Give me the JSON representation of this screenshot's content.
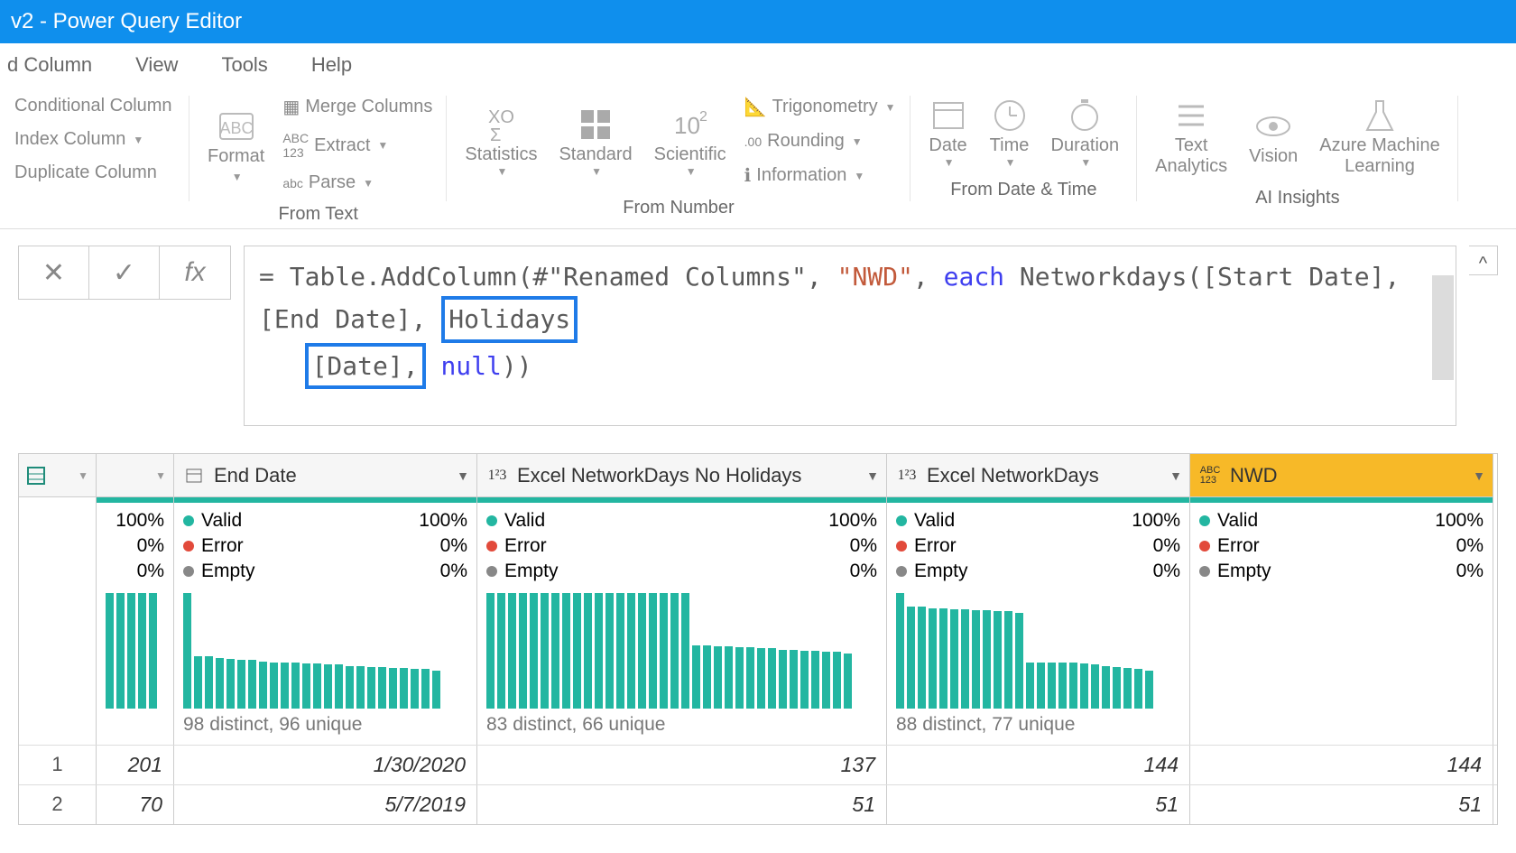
{
  "title": "v2 - Power Query Editor",
  "menu": {
    "add_column": "d Column",
    "view": "View",
    "tools": "Tools",
    "help": "Help"
  },
  "ribbon": {
    "conditional": "Conditional Column",
    "index": "Index Column",
    "duplicate": "Duplicate Column",
    "format": "Format",
    "merge": "Merge Columns",
    "extract": "Extract",
    "parse": "Parse",
    "group_text": "From Text",
    "statistics": "Statistics",
    "standard": "Standard",
    "scientific": "Scientific",
    "trig": "Trigonometry",
    "rounding": "Rounding",
    "information": "Information",
    "group_number": "From Number",
    "date": "Date",
    "time": "Time",
    "duration": "Duration",
    "group_datetime": "From Date & Time",
    "text_analytics": "Text\nAnalytics",
    "vision": "Vision",
    "azure": "Azure Machine\nLearning",
    "group_ai": "AI Insights"
  },
  "formula": {
    "pre1": "= Table.AddColumn(#\"Renamed Columns\", ",
    "str": "\"NWD\"",
    "comma1": ", ",
    "each": "each",
    "mid": " Networkdays([Start Date], [End Date],",
    "hl1": "Holidays",
    "hl2": "[Date],",
    "null": "null",
    "tail": "))"
  },
  "columns": [
    {
      "name": "End Date",
      "type": "date",
      "valid": "100%",
      "error": "0%",
      "empty": "0%",
      "distinct": "98 distinct, 96 unique"
    },
    {
      "name": "Excel NetworkDays No Holidays",
      "type": "num",
      "valid": "100%",
      "error": "0%",
      "empty": "0%",
      "distinct": "83 distinct, 66 unique"
    },
    {
      "name": "Excel NetworkDays",
      "type": "num",
      "valid": "100%",
      "error": "0%",
      "empty": "0%",
      "distinct": "88 distinct, 77 unique"
    },
    {
      "name": "NWD",
      "type": "any",
      "valid": "100%",
      "error": "0%",
      "empty": "0%",
      "distinct": ""
    }
  ],
  "numcol": {
    "valid": "100%",
    "error": "0%",
    "empty": "0%"
  },
  "labels": {
    "valid": "Valid",
    "error": "Error",
    "empty": "Empty"
  },
  "rows": [
    {
      "n": "1",
      "c0": "201",
      "c1": "1/30/2020",
      "c2": "137",
      "c3": "144",
      "c4": "144"
    },
    {
      "n": "2",
      "c0": "70",
      "c1": "5/7/2019",
      "c2": "51",
      "c3": "51",
      "c4": "51"
    }
  ],
  "chart_data": [
    {
      "type": "bar",
      "title": "End Date distribution",
      "values": [
        100,
        45,
        45,
        44,
        43,
        42,
        42,
        41,
        40,
        40,
        40,
        39,
        39,
        38,
        38,
        37,
        37,
        36,
        36,
        35,
        35,
        34,
        34,
        33
      ],
      "ylim": [
        0,
        100
      ]
    },
    {
      "type": "bar",
      "title": "Excel NetworkDays No Holidays distribution",
      "values": [
        100,
        100,
        100,
        100,
        100,
        100,
        100,
        100,
        100,
        100,
        100,
        100,
        100,
        100,
        100,
        100,
        100,
        100,
        100,
        55,
        55,
        54,
        54,
        53,
        53,
        52,
        52,
        51,
        51,
        50,
        50,
        49,
        49,
        48
      ],
      "ylim": [
        0,
        100
      ]
    },
    {
      "type": "bar",
      "title": "Excel NetworkDays distribution",
      "values": [
        100,
        88,
        88,
        87,
        87,
        86,
        86,
        85,
        85,
        84,
        84,
        83,
        40,
        40,
        40,
        40,
        40,
        39,
        38,
        37,
        36,
        35,
        34,
        33
      ],
      "ylim": [
        0,
        100
      ]
    }
  ]
}
